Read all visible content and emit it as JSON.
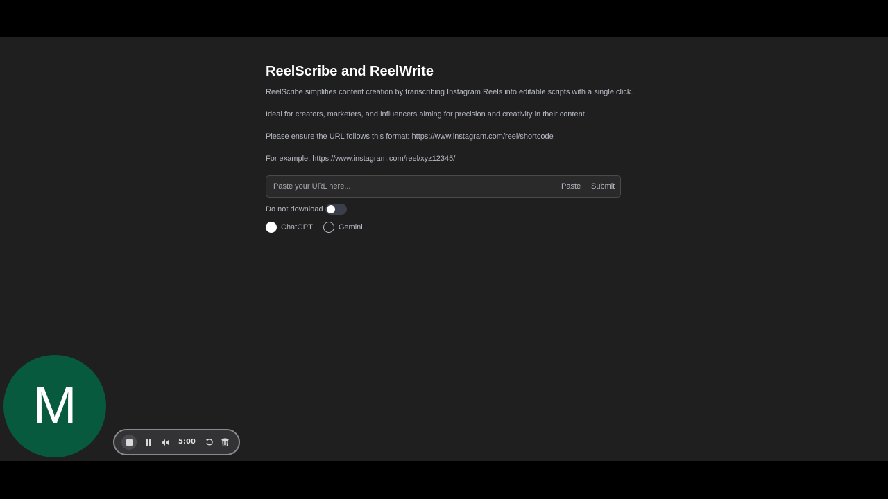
{
  "app": {
    "title": "ReelScribe and ReelWrite",
    "paragraphs": [
      "ReelScribe simplifies content creation by transcribing Instagram Reels into editable scripts with a single click.",
      "Ideal for creators, marketers, and influencers aiming for precision and creativity in their content.",
      "Please ensure the URL follows this format: https://www.instagram.com/reel/shortcode",
      "For example: https://www.instagram.com/reel/xyz12345/"
    ]
  },
  "url_form": {
    "value": "",
    "placeholder": "Paste your URL here...",
    "paste_label": "Paste",
    "submit_label": "Submit"
  },
  "options": {
    "toggle_label": "Do not download",
    "toggle_on": false,
    "models": [
      {
        "label": "ChatGPT",
        "selected": true
      },
      {
        "label": "Gemini",
        "selected": false
      }
    ]
  },
  "overlay": {
    "avatar_letter": "M",
    "avatar_color": "#075a3d",
    "timer": "5:00",
    "icons": [
      "stop-icon",
      "pause-icon",
      "rewind-icon",
      "restart-icon",
      "trash-icon"
    ]
  }
}
